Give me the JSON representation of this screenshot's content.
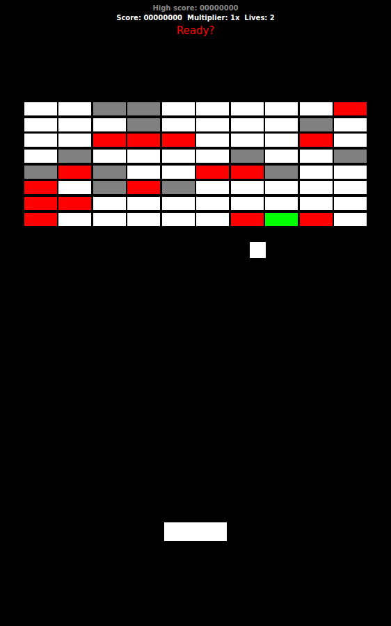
{
  "hud": {
    "high_score": "High score: 00000000",
    "status": "Score: 00000000  Multiplier: 1x  Lives: 2",
    "message": "Ready?"
  },
  "bricks": [
    [
      {
        "color": "#ffffff"
      },
      {
        "color": "#ffffff"
      },
      {
        "color": "#808080"
      },
      {
        "color": "#808080"
      },
      {
        "color": "#ffffff"
      },
      {
        "color": "#ffffff"
      },
      {
        "color": "#ffffff"
      },
      {
        "color": "#ffffff"
      },
      {
        "color": "#ffffff"
      },
      {
        "color": "#ff0000"
      }
    ],
    [
      {
        "color": "#ffffff"
      },
      {
        "color": "#ffffff"
      },
      {
        "color": "#ffffff"
      },
      {
        "color": "#808080"
      },
      {
        "color": "#ffffff"
      },
      {
        "color": "#ffffff"
      },
      {
        "color": "#ffffff"
      },
      {
        "color": "#ffffff"
      },
      {
        "color": "#808080"
      },
      {
        "color": "#ffffff"
      }
    ],
    [
      {
        "color": "#ffffff"
      },
      {
        "color": "#ffffff"
      },
      {
        "color": "#ff0000"
      },
      {
        "color": "#ff0000"
      },
      {
        "color": "#ff0000"
      },
      {
        "color": "#ffffff"
      },
      {
        "color": "#ffffff"
      },
      {
        "color": "#ffffff"
      },
      {
        "color": "#ff0000"
      },
      {
        "color": "#ffffff"
      }
    ],
    [
      {
        "color": "#ffffff"
      },
      {
        "color": "#808080"
      },
      {
        "color": "#ffffff"
      },
      {
        "color": "#ffffff"
      },
      {
        "color": "#ffffff"
      },
      {
        "color": "#ffffff"
      },
      {
        "color": "#808080"
      },
      {
        "color": "#ffffff"
      },
      {
        "color": "#ffffff"
      },
      {
        "color": "#808080"
      }
    ],
    [
      {
        "color": "#808080"
      },
      {
        "color": "#ff0000"
      },
      {
        "color": "#808080"
      },
      {
        "color": "#ffffff"
      },
      {
        "color": "#ffffff"
      },
      {
        "color": "#ff0000"
      },
      {
        "color": "#ff0000"
      },
      {
        "color": "#808080"
      },
      {
        "color": "#ffffff"
      },
      {
        "color": "#ffffff"
      }
    ],
    [
      {
        "color": "#ff0000"
      },
      {
        "color": "#ffffff"
      },
      {
        "color": "#808080"
      },
      {
        "color": "#ff0000"
      },
      {
        "color": "#808080"
      },
      {
        "color": "#ffffff"
      },
      {
        "color": "#ffffff"
      },
      {
        "color": "#ffffff"
      },
      {
        "color": "#ffffff"
      },
      {
        "color": "#ffffff"
      }
    ],
    [
      {
        "color": "#ff0000"
      },
      {
        "color": "#ff0000"
      },
      {
        "color": "#ffffff"
      },
      {
        "color": "#ffffff"
      },
      {
        "color": "#ffffff"
      },
      {
        "color": "#ffffff"
      },
      {
        "color": "#ffffff"
      },
      {
        "color": "#ffffff"
      },
      {
        "color": "#ffffff"
      },
      {
        "color": "#ffffff"
      }
    ],
    [
      {
        "color": "#ff0000"
      },
      {
        "color": "#ffffff"
      },
      {
        "color": "#ffffff"
      },
      {
        "color": "#ffffff"
      },
      {
        "color": "#ffffff"
      },
      {
        "color": "#ffffff"
      },
      {
        "color": "#ff0000"
      },
      {
        "color": "#00ff00"
      },
      {
        "color": "#ff0000"
      },
      {
        "color": "#ffffff"
      }
    ]
  ]
}
